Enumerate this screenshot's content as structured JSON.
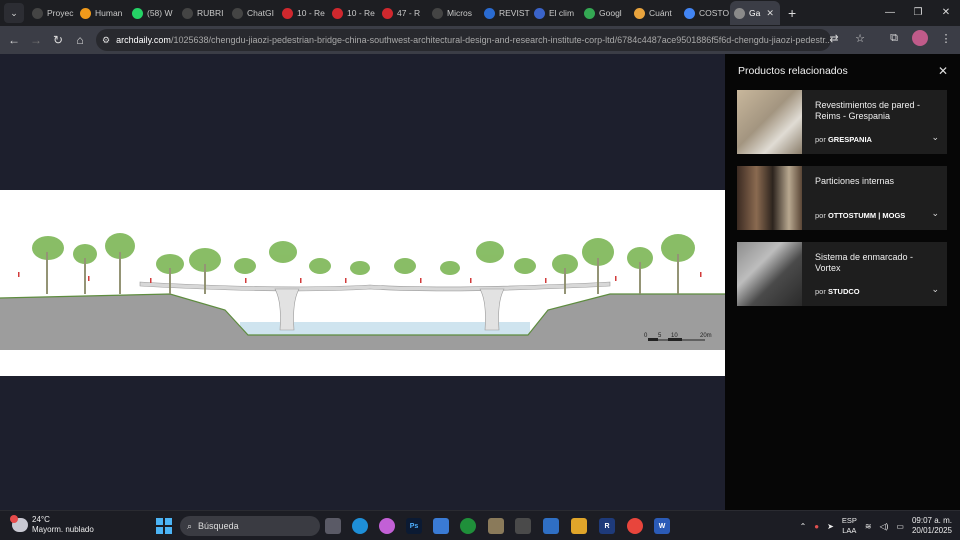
{
  "browser": {
    "tabs": [
      {
        "label": "Proyec",
        "icon": "chatgpt-icon",
        "color": "#444"
      },
      {
        "label": "Human",
        "icon": "amazon-icon",
        "color": "#f09a1b"
      },
      {
        "label": "(58) W",
        "icon": "whatsapp-icon",
        "color": "#25d366"
      },
      {
        "label": "RUBRI",
        "icon": "chatgpt-icon",
        "color": "#444"
      },
      {
        "label": "ChatGI",
        "icon": "chatgpt-icon",
        "color": "#444"
      },
      {
        "label": "10 - Re",
        "icon": "pdf-icon",
        "color": "#d0282e"
      },
      {
        "label": "10 - Re",
        "icon": "pdf-icon",
        "color": "#d0282e"
      },
      {
        "label": "47 - R",
        "icon": "pdf-icon",
        "color": "#d0282e"
      },
      {
        "label": "Micros",
        "icon": "chatgpt-icon",
        "color": "#444"
      },
      {
        "label": "REVIST",
        "icon": "revista-icon",
        "color": "#2a6bd1"
      },
      {
        "label": "El clim",
        "icon": "weather-site-icon",
        "color": "#3a63c9"
      },
      {
        "label": "Googl",
        "icon": "maps-icon",
        "color": "#34a853"
      },
      {
        "label": "Cuánt",
        "icon": "tab-page-icon",
        "color": "#e8a33d"
      },
      {
        "label": "COSTO",
        "icon": "google-icon",
        "color": "#4285f4"
      },
      {
        "label": "Ga",
        "icon": "globe-icon",
        "color": "#8a8a8a",
        "active": true
      }
    ],
    "address": {
      "host": "archdaily.com",
      "path": "/1025638/chengdu-jiaozi-pedestrian-bridge-china-southwest-architectural-design-and-research-institute-corp-ltd/6784c4487ace9501886f5f6d-chengdu-jiaozi-pedestr..."
    }
  },
  "drawing": {
    "scale_labels": [
      "0",
      "5",
      "10",
      "20m"
    ]
  },
  "sidebar": {
    "title": "Productos relacionados",
    "products": [
      {
        "name": "Revestimientos de pared - Reims - Grespania",
        "by_prefix": "por",
        "brand": "GRESPANIA"
      },
      {
        "name": "Particiones internas",
        "by_prefix": "por",
        "brand": "OTTOSTUMM | MOGS"
      },
      {
        "name": "Sistema de enmarcado - Vortex",
        "by_prefix": "por",
        "brand": "STUDCO"
      }
    ]
  },
  "taskbar": {
    "weather_temp": "24°C",
    "weather_desc": "Mayorm. nublado",
    "search_placeholder": "Búsqueda",
    "lang_primary": "ESP",
    "lang_secondary": "LAA",
    "time": "09:07 a. m.",
    "date": "20/01/2025"
  }
}
